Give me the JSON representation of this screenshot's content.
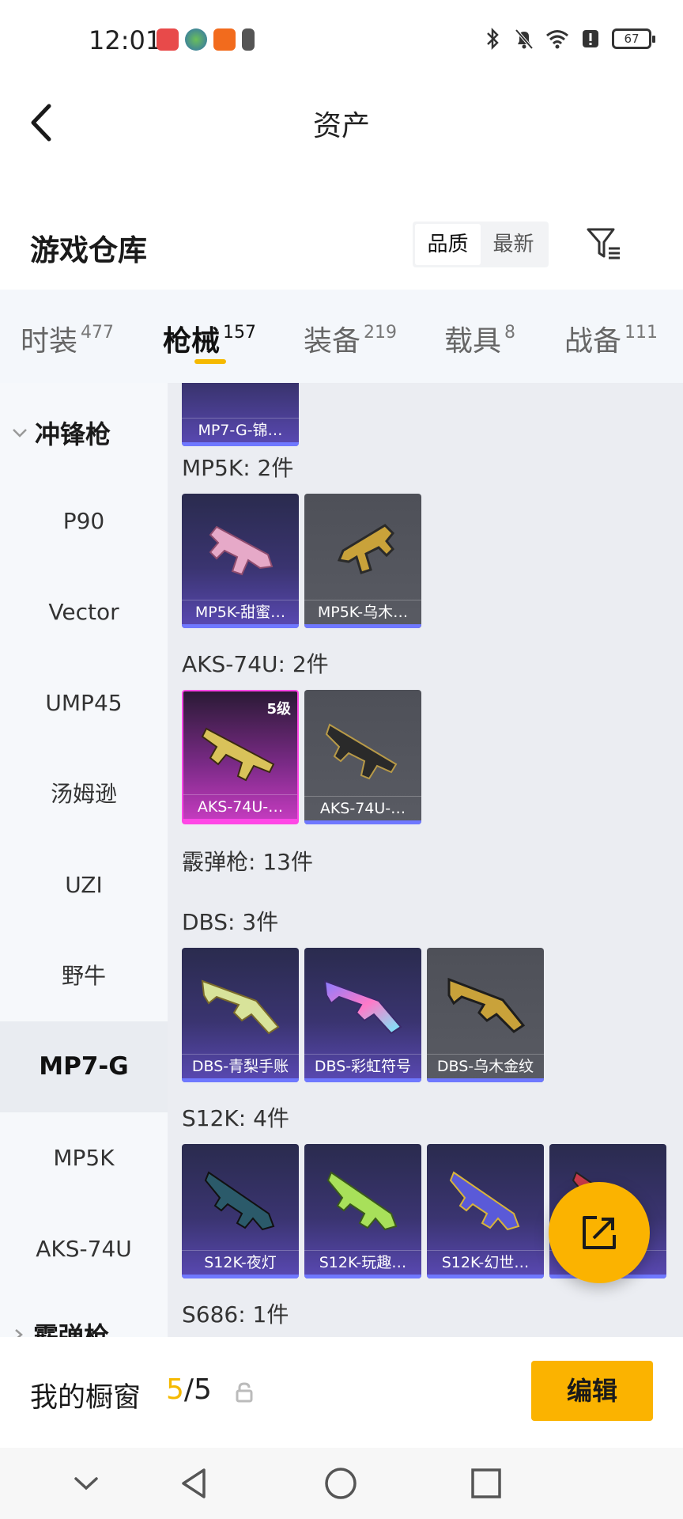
{
  "status_bar": {
    "time": "12:01",
    "battery": "67"
  },
  "header": {
    "title": "资产"
  },
  "warehouse": {
    "title": "游戏仓库",
    "sort_options": [
      "品质",
      "最新"
    ],
    "sort_active": "品质"
  },
  "tabs": [
    {
      "label": "时装",
      "count": "477"
    },
    {
      "label": "枪械",
      "count": "157"
    },
    {
      "label": "装备",
      "count": "219"
    },
    {
      "label": "载具",
      "count": "8"
    },
    {
      "label": "战备",
      "count": "111"
    }
  ],
  "active_tab": "枪械",
  "sidebar": {
    "group": "冲锋枪",
    "items": [
      "P90",
      "Vector",
      "UMP45",
      "汤姆逊",
      "UZI",
      "野牛",
      "MP7-G",
      "MP5K",
      "AKS-74U"
    ],
    "active_item": "MP7-G",
    "next_group": "霰弹枪"
  },
  "content": {
    "top_card": "MP7-G-锦…",
    "sections": [
      {
        "label": "MP5K: 2件",
        "cards": [
          "MP5K-甜蜜…",
          "MP5K-乌木…"
        ]
      },
      {
        "label": "AKS-74U: 2件",
        "cards": [
          "AKS-74U-…",
          "AKS-74U-…"
        ],
        "level_badge": "5级"
      },
      {
        "label": "霰弹枪: 13件"
      },
      {
        "label": "DBS: 3件",
        "cards": [
          "DBS-青梨手账",
          "DBS-彩虹符号",
          "DBS-乌木金纹"
        ]
      },
      {
        "label": "S12K: 4件",
        "cards": [
          "S12K-夜灯",
          "S12K-玩趣…",
          "S12K-幻世…",
          "…"
        ]
      },
      {
        "label": "S686: 1件"
      }
    ]
  },
  "showcase": {
    "label": "我的橱窗",
    "count_current": "5",
    "count_total": "/5",
    "edit_label": "编辑"
  },
  "icons": {
    "back": "back-arrow-icon",
    "filter": "filter-icon",
    "share": "share-icon",
    "lock": "lock-icon"
  },
  "colors": {
    "accent": "#fbb300",
    "underline": "#f5b900",
    "epic_card": "#5a49b4",
    "legendary_card": "#c83cc2"
  }
}
